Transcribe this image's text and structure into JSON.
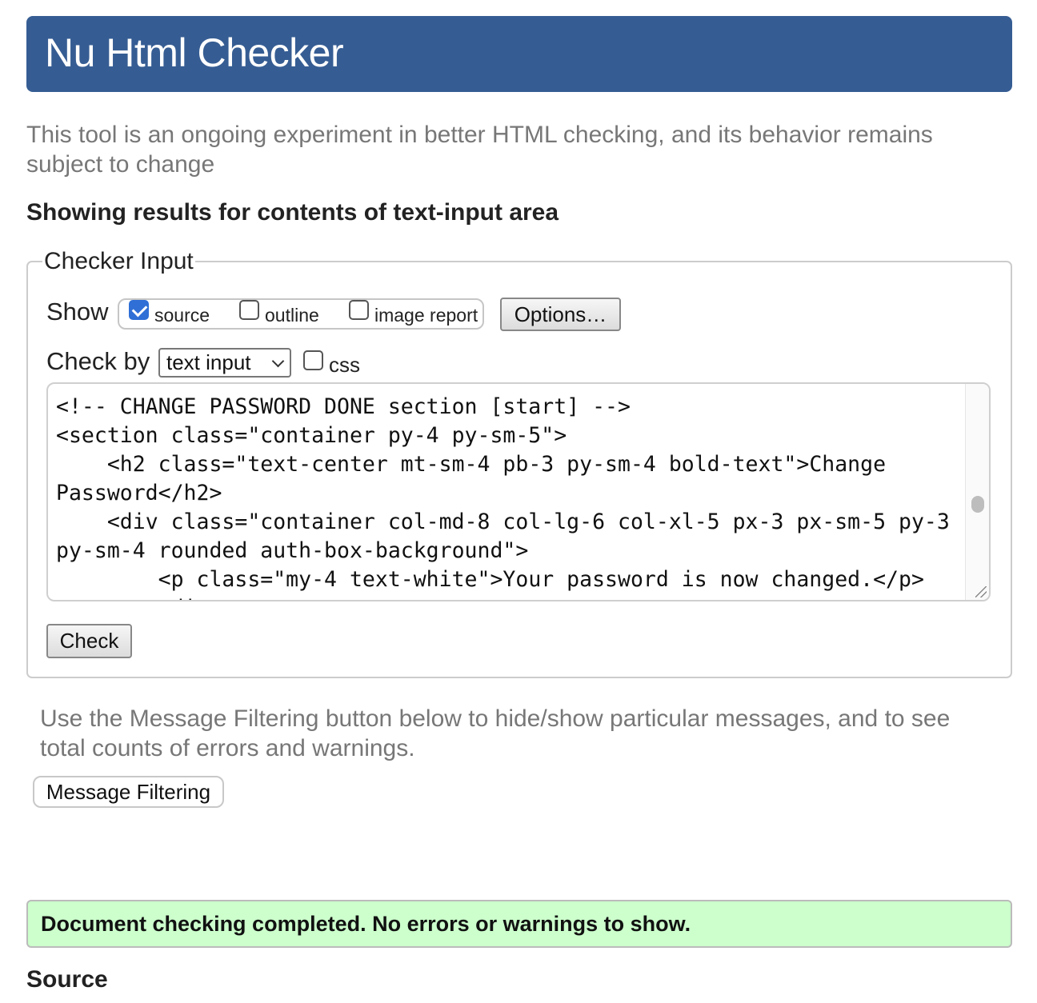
{
  "app": {
    "title": "Nu Html Checker"
  },
  "intro": "This tool is an ongoing experiment in better HTML checking, and its behavior remains subject to change",
  "results_heading": "Showing results for contents of text-input area",
  "checker": {
    "legend": "Checker Input",
    "show_label": "Show",
    "show_options": [
      {
        "label": "source",
        "checked": true
      },
      {
        "label": "outline",
        "checked": false
      },
      {
        "label": "image report",
        "checked": false
      }
    ],
    "options_button": "Options…",
    "checkby_label": "Check by",
    "checkby_select_value": "text input",
    "css_label": "css",
    "css_checked": false,
    "textarea_value": "<!-- CHANGE PASSWORD DONE section [start] -->\n<section class=\"container py-4 py-sm-5\">\n    <h2 class=\"text-center mt-sm-4 pb-3 py-sm-4 bold-text\">Change Password</h2>\n    <div class=\"container col-md-8 col-lg-6 col-xl-5 px-3 px-sm-5 py-3 py-sm-4 rounded auth-box-background\">\n        <p class=\"my-4 text-white\">Your password is now changed.</p>\n        <div",
    "check_button": "Check"
  },
  "filter_note": "Use the Message Filtering button below to hide/show particular messages, and to see total counts of errors and warnings.",
  "message_filtering_button": "Message Filtering",
  "success_message": "Document checking completed. No errors or warnings to show.",
  "source_heading": "Source",
  "colors": {
    "header_bg": "#365d93",
    "success_bg": "#ccffcc",
    "checkbox_accent": "#2f6fd6"
  }
}
